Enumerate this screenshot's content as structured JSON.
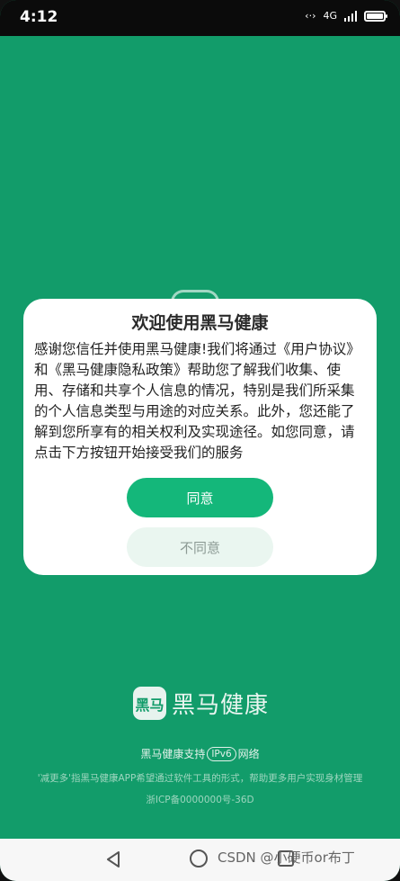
{
  "status_bar": {
    "time": "4:12",
    "network_label": "4G"
  },
  "dialog": {
    "title": "欢迎使用黑马健康",
    "body": "感谢您信任并使用黑马健康!我们将通过《用户协议》和《黑马健康隐私政策》帮助您了解我们收集、使用、存储和共享个人信息的情况，特别是我们所采集的个人信息类型与用途的对应关系。此外，您还能了解到您所享有的相关权利及实现途径。如您同意，请点击下方按钮开始接受我们的服务",
    "agree_label": "同意",
    "disagree_label": "不同意"
  },
  "footer": {
    "brand_icon_text": "黑马",
    "brand_name": "黑马健康",
    "support_prefix": "黑马健康支持",
    "ipv6_badge": "IPv6",
    "support_suffix": "网络",
    "slogan": "'减更多'指黑马健康APP希望通过软件工具的形式，帮助更多用户实现身材管理",
    "icp": "浙ICP备0000000号-36D"
  },
  "nav_bar": {
    "watermark": "CSDN @小硬币or布丁"
  },
  "colors": {
    "background": "#129c6a",
    "accent": "#14b77a",
    "disagree_bg": "#eaf6f0"
  }
}
